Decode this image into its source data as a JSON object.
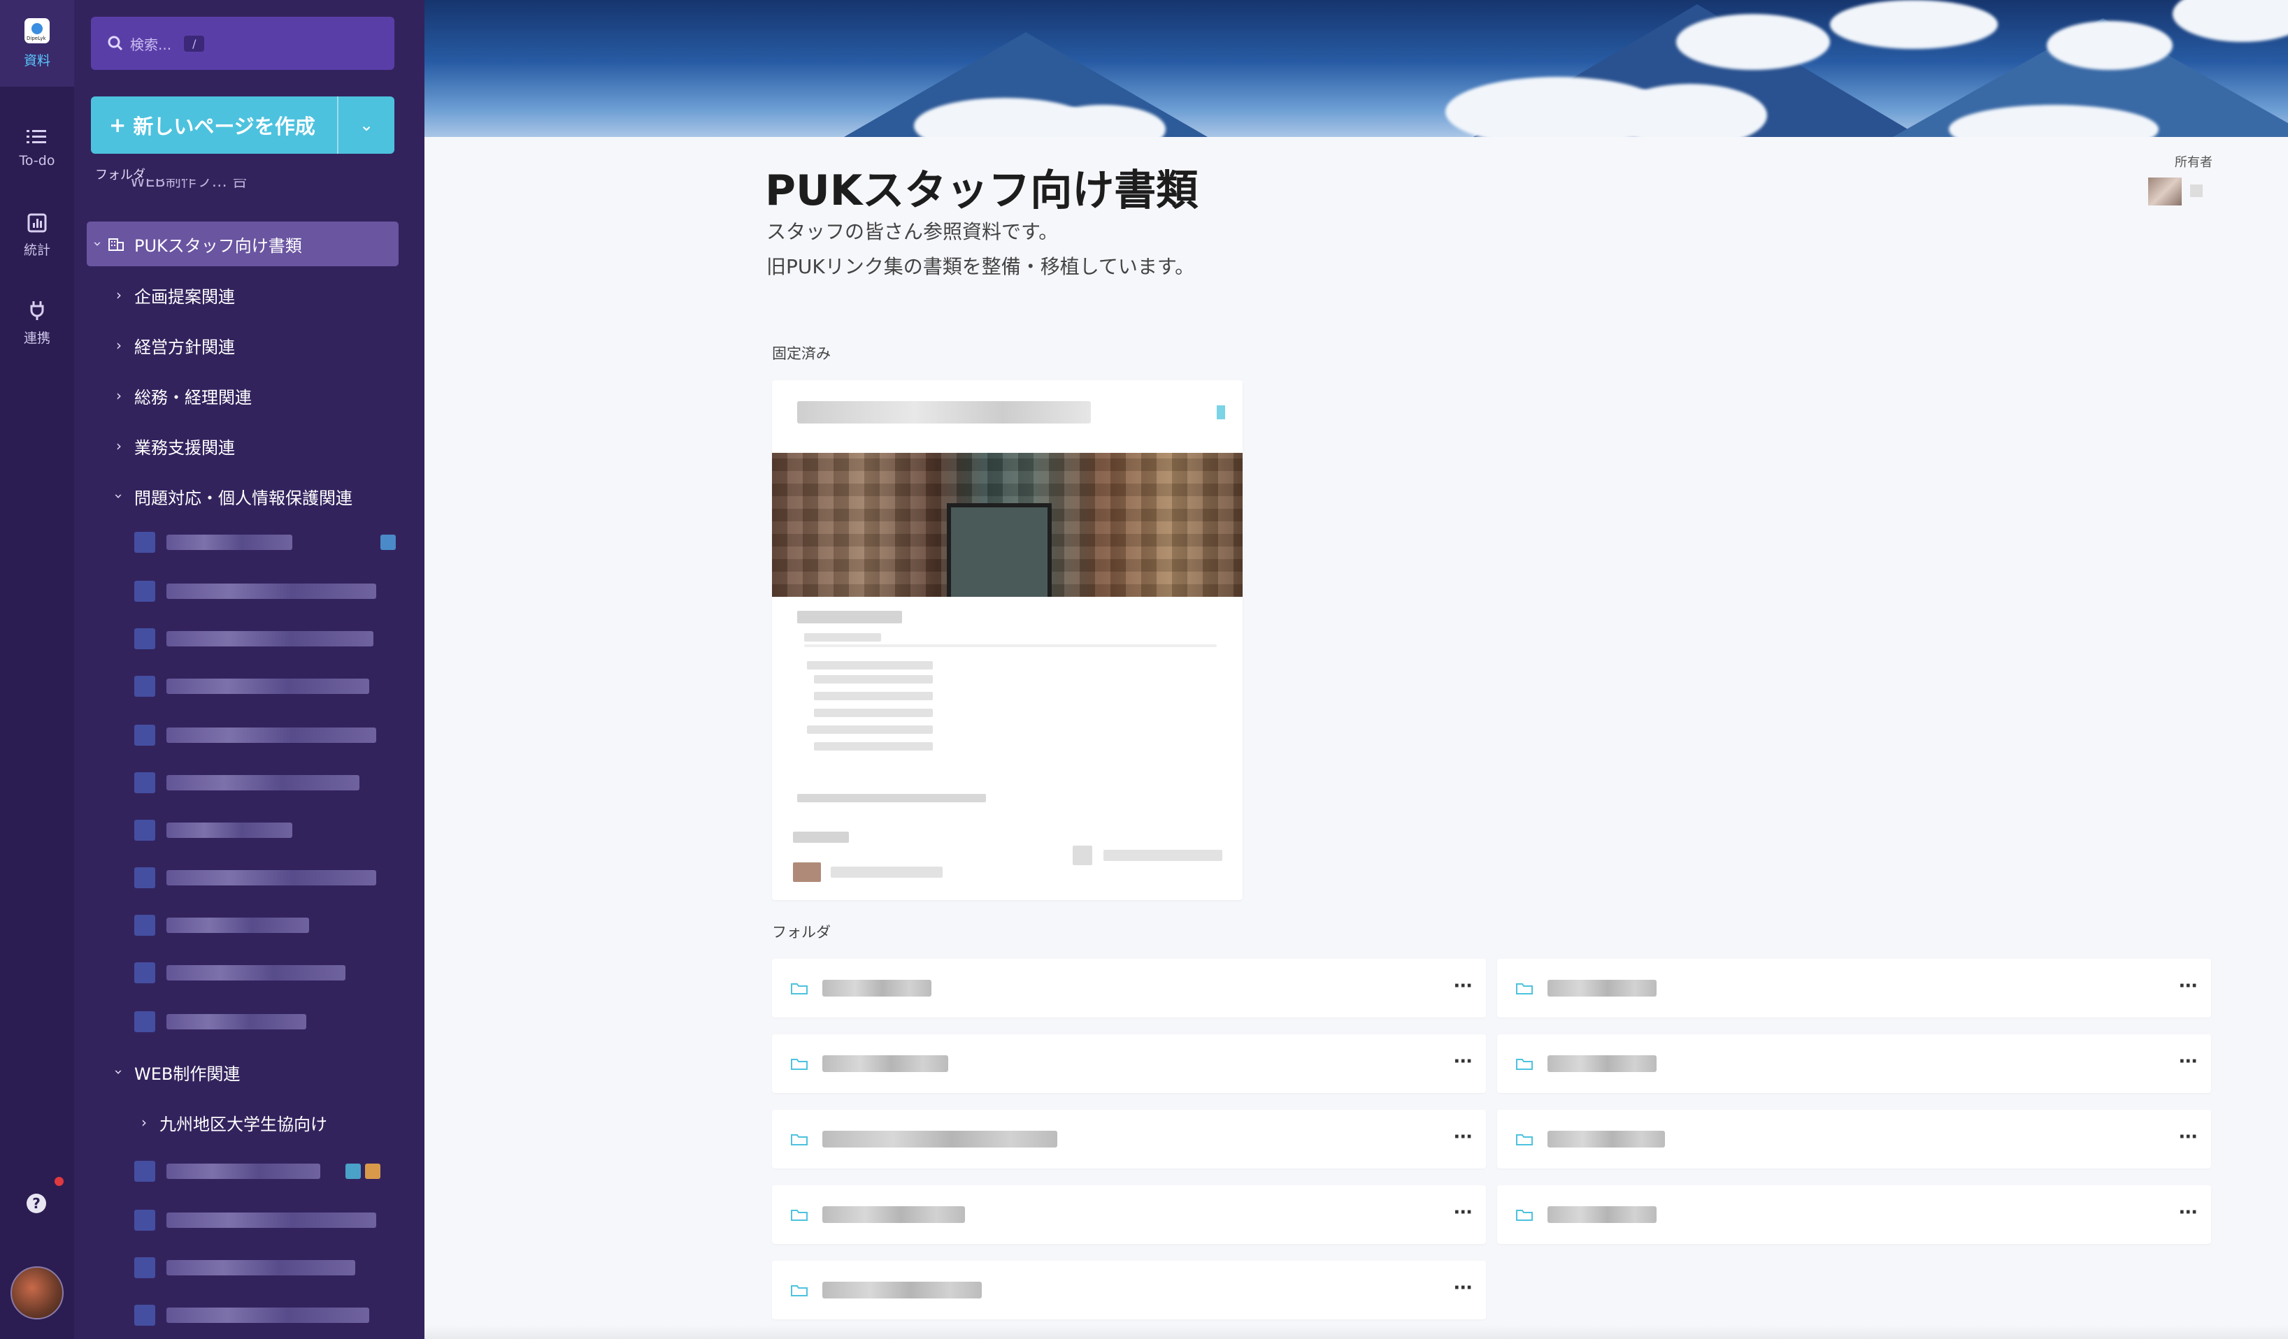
{
  "rail": {
    "items": [
      {
        "label": "資料",
        "icon": "docs-logo-icon",
        "active": true
      },
      {
        "label": "To-do",
        "icon": "list-icon"
      },
      {
        "label": "統計",
        "icon": "chart-icon"
      },
      {
        "label": "連携",
        "icon": "plug-icon"
      }
    ],
    "logo_text": "DipeLyk",
    "help_symbol": "?"
  },
  "sidebar": {
    "search_placeholder": "検索...",
    "search_shortcut": "/",
    "create_button": "新しいページを作成",
    "create_plus": "+",
    "create_caret": "⌄",
    "folder_heading": "フォルダ",
    "cut_item": "WEB制作フ…  台",
    "tree": [
      {
        "label": "PUKスタッフ向け書類",
        "chevron": "›"
      },
      {
        "label": "企画提案関連",
        "chevron": "›"
      },
      {
        "label": "経営方針関連",
        "chevron": "›"
      },
      {
        "label": "総務・経理関連",
        "chevron": "›"
      },
      {
        "label": "業務支援関連",
        "chevron": "›"
      },
      {
        "label": "問題対応・個人情報保護関連",
        "chevron": "›"
      },
      {
        "label": "WEB制作関連",
        "chevron": "›"
      },
      {
        "label": "九州地区大学生協向け",
        "chevron": "›"
      }
    ]
  },
  "main": {
    "title": "PUKスタッフ向け書類",
    "description_line1": "スタッフの皆さん参照資料です。",
    "description_line2": "旧PUKリンク集の書類を整備・移植しています。",
    "owner_label": "所有者",
    "pinned_label": "固定済み",
    "folders_label": "フォルダ",
    "more_symbol": "···"
  },
  "colors": {
    "rail_bg": "#2b1d52",
    "sidebar_bg": "#33235d",
    "selected_bg": "#6a55a1",
    "accent": "#4dc2de",
    "search_bg": "#5a3ea8"
  }
}
